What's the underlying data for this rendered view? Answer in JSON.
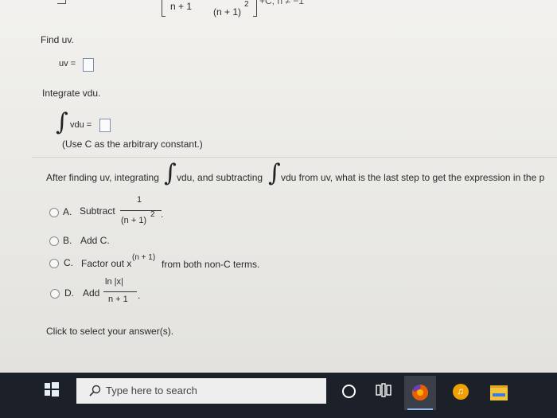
{
  "top_fragment": {
    "numerator": "n + 1",
    "denominator": "(n + 1)",
    "denominator_exp": "2",
    "tail": "+C, n ≠ −1"
  },
  "find_uv": {
    "prompt": "Find uv.",
    "label": "uv ="
  },
  "integrate": {
    "prompt": "Integrate vdu.",
    "integral_symbol": "∫",
    "label": "vdu =",
    "note": "(Use C as the arbitrary constant.)"
  },
  "question": {
    "part1": "After finding uv, integrating",
    "int1": "vdu, and subtracting",
    "int2": "vdu from uv, what is the last step to get the expression in the p"
  },
  "options": [
    {
      "letter": "A.",
      "text": "Subtract",
      "num": "1",
      "den": "(n + 1)",
      "exp": "2",
      "end": "."
    },
    {
      "letter": "B.",
      "text": "Add C."
    },
    {
      "letter": "C.",
      "text": "Factor out x",
      "exp": "(n + 1)",
      "end": "from both non-C terms."
    },
    {
      "letter": "D.",
      "text": "Add",
      "num": "ln |x|",
      "den": "n + 1",
      "end": "."
    }
  ],
  "footer": "Click to select your answer(s).",
  "taskbar": {
    "search_placeholder": "Type here to search",
    "icons": [
      "windows-start-icon",
      "search-icon",
      "cortana-icon",
      "task-view-icon",
      "firefox-icon",
      "music-app-icon",
      "file-explorer-icon"
    ],
    "colors": {
      "bar": "#1c2028",
      "search_bg": "#eeeeee",
      "firefox": "#e66000",
      "music": "#f0a000",
      "explorer": "#f3c13a"
    }
  }
}
